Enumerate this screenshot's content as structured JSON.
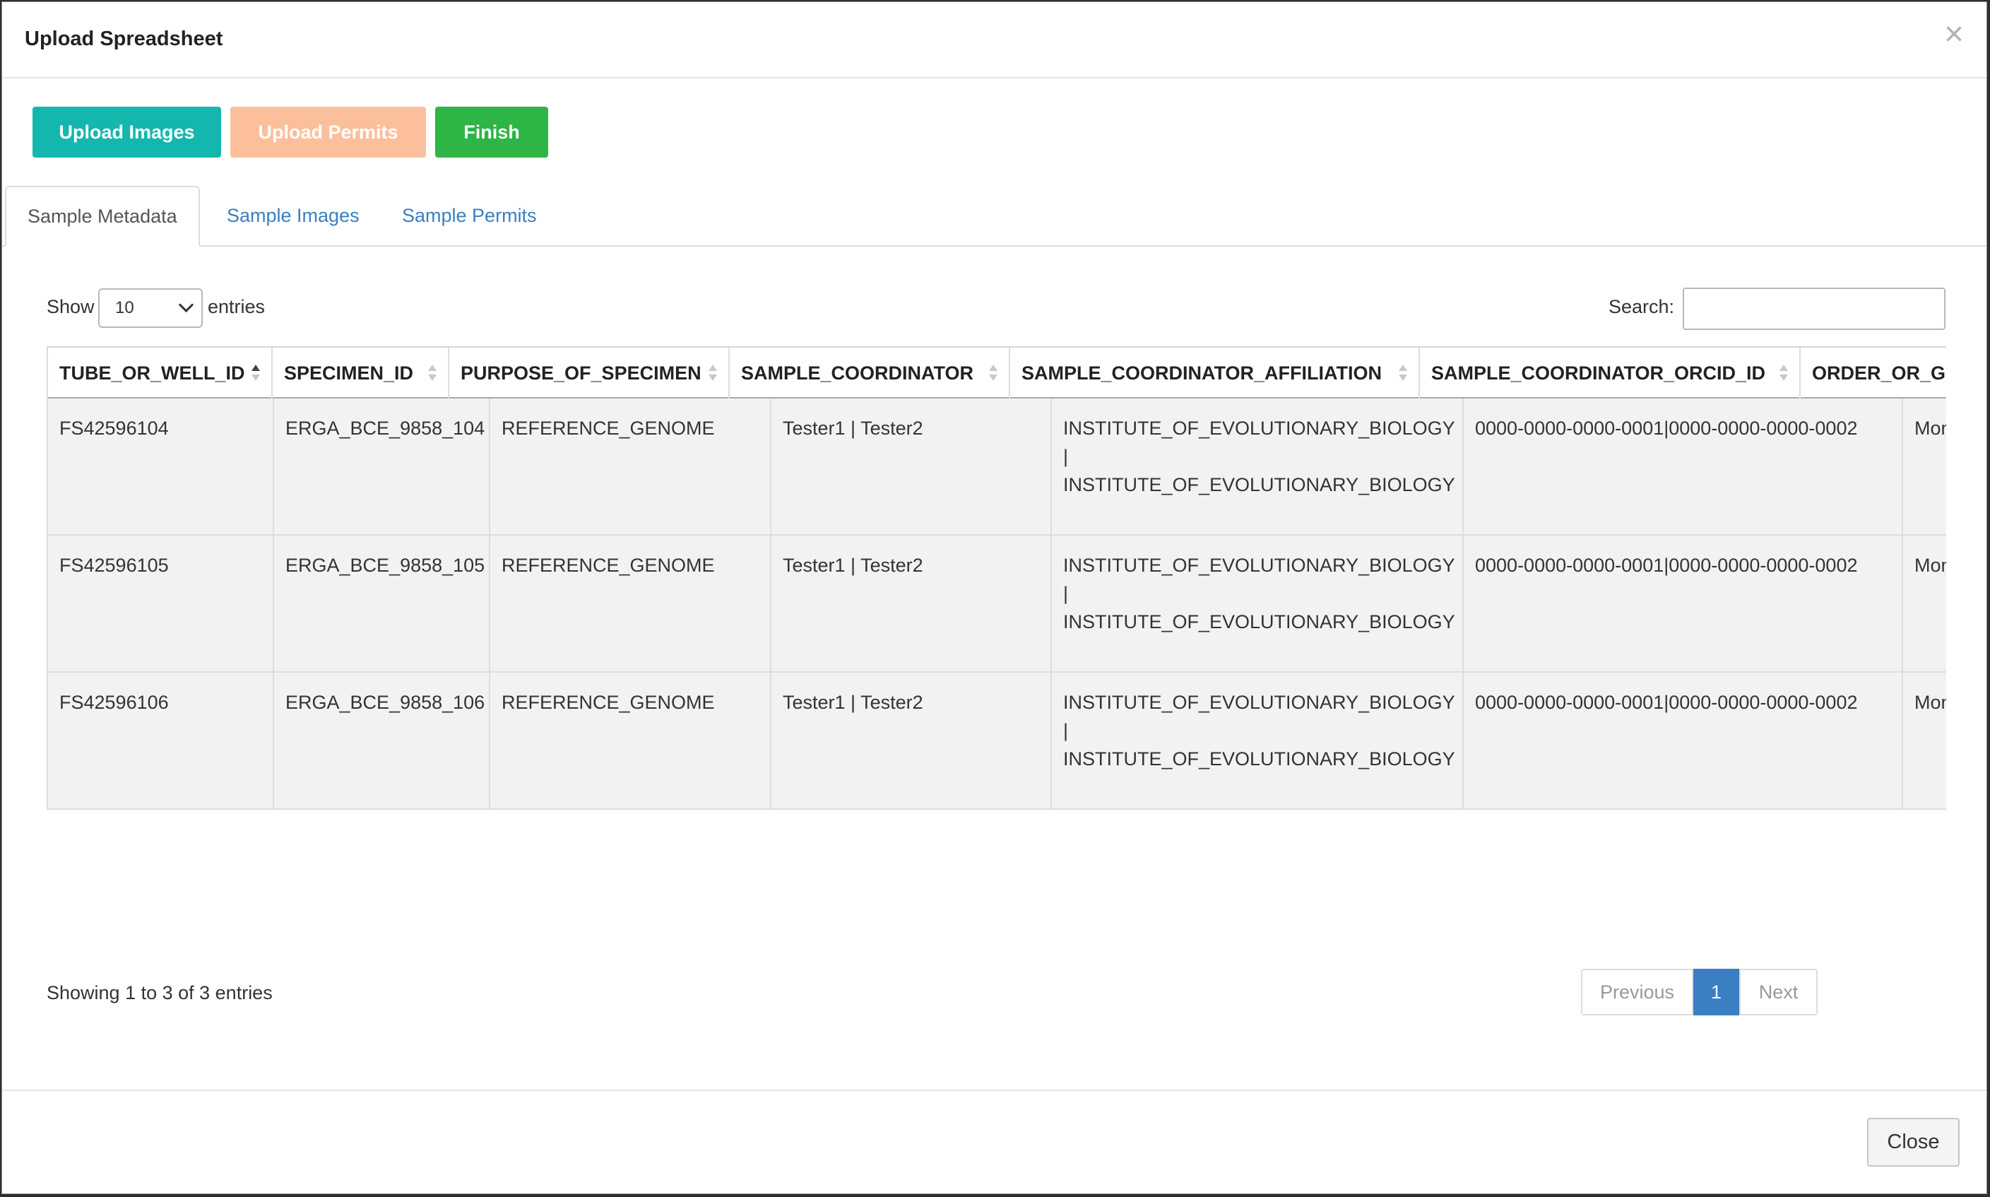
{
  "modal": {
    "title": "Upload Spreadsheet",
    "close_icon": "×",
    "close_button": "Close"
  },
  "toolbar": {
    "upload_images": "Upload Images",
    "upload_permits": "Upload Permits",
    "finish": "Finish",
    "colors": {
      "upload_images": "#13b7ae",
      "upload_permits": "#fbbf9c",
      "finish": "#2db546"
    }
  },
  "tabs": [
    {
      "label": "Sample Metadata",
      "active": true
    },
    {
      "label": "Sample Images",
      "active": false
    },
    {
      "label": "Sample Permits",
      "active": false
    }
  ],
  "table_controls": {
    "show_label": "Show",
    "entries_label": "entries",
    "page_length": "10",
    "search_label": "Search:",
    "search_value": ""
  },
  "table": {
    "columns": [
      "TUBE_OR_WELL_ID",
      "SPECIMEN_ID",
      "PURPOSE_OF_SPECIMEN",
      "SAMPLE_COORDINATOR",
      "SAMPLE_COORDINATOR_AFFILIATION",
      "SAMPLE_COORDINATOR_ORCID_ID",
      "ORDER_OR_GR"
    ],
    "rows": [
      {
        "tube": "FS42596104",
        "specimen": "ERGA_BCE_9858_104",
        "purpose": "REFERENCE_GENOME",
        "coordinator": "Tester1 | Tester2",
        "affiliation_1": "INSTITUTE_OF_EVOLUTIONARY_BIOLOGY",
        "affiliation_sep": "|",
        "affiliation_2": "INSTITUTE_OF_EVOLUTIONARY_BIOLOGY",
        "orcid": "0000-0000-0000-0001|0000-0000-0000-0002",
        "order": "Mon"
      },
      {
        "tube": "FS42596105",
        "specimen": "ERGA_BCE_9858_105",
        "purpose": "REFERENCE_GENOME",
        "coordinator": "Tester1 | Tester2",
        "affiliation_1": "INSTITUTE_OF_EVOLUTIONARY_BIOLOGY",
        "affiliation_sep": "|",
        "affiliation_2": "INSTITUTE_OF_EVOLUTIONARY_BIOLOGY",
        "orcid": "0000-0000-0000-0001|0000-0000-0000-0002",
        "order": "Mon"
      },
      {
        "tube": "FS42596106",
        "specimen": "ERGA_BCE_9858_106",
        "purpose": "REFERENCE_GENOME",
        "coordinator": "Tester1 | Tester2",
        "affiliation_1": "INSTITUTE_OF_EVOLUTIONARY_BIOLOGY",
        "affiliation_sep": "|",
        "affiliation_2": "INSTITUTE_OF_EVOLUTIONARY_BIOLOGY",
        "orcid": "0000-0000-0000-0001|0000-0000-0000-0002",
        "order": "Mon"
      }
    ]
  },
  "footer_info": "Showing 1 to 3 of 3 entries",
  "pagination": {
    "previous": "Previous",
    "current": "1",
    "next": "Next"
  }
}
